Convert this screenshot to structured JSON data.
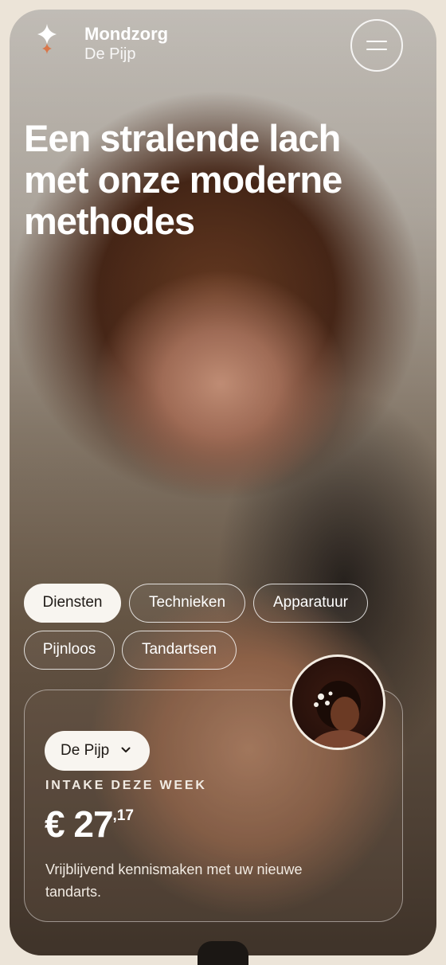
{
  "brand": {
    "name": "Mondzorg",
    "location": "De Pijp"
  },
  "hero": {
    "headline": "Een stralende lach met onze moderne methodes"
  },
  "chips": [
    "Diensten",
    "Technieken",
    "Apparatuur",
    "Pijnloos",
    "Tandartsen"
  ],
  "active_chip": "Diensten",
  "card": {
    "location_label": "De Pijp",
    "intake_label": "INTAKE DEZE WEEK",
    "price_main": "€ 27",
    "price_cents": ",17",
    "description": "Vrijblijvend kennismaken met uw nieuwe tandarts."
  },
  "colors": {
    "chip_active_bg": "#f8f5f0",
    "text_dark": "#1f1a16",
    "accent_logo": "#d9774a"
  }
}
